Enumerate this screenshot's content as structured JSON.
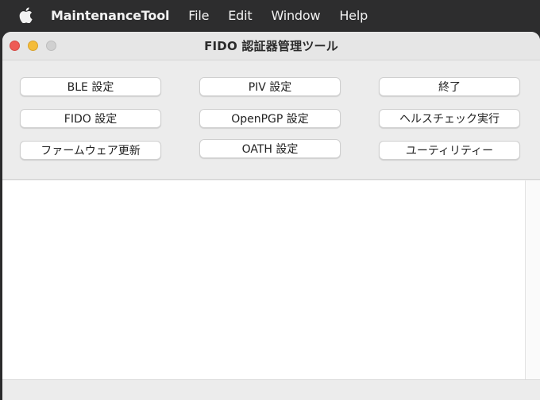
{
  "menubar": {
    "app_name": "MaintenanceTool",
    "items": [
      "File",
      "Edit",
      "Window",
      "Help"
    ]
  },
  "window": {
    "title": "FIDO 認証器管理ツール"
  },
  "buttons": {
    "ble": "BLE 設定",
    "piv": "PIV 設定",
    "quit": "終了",
    "fido": "FIDO 設定",
    "openpgp": "OpenPGP 設定",
    "healthcheck": "ヘルスチェック実行",
    "firmware": "ファームウェア更新",
    "oath": "OATH 設定",
    "utility": "ユーティリティー"
  },
  "log": {
    "text": ""
  }
}
